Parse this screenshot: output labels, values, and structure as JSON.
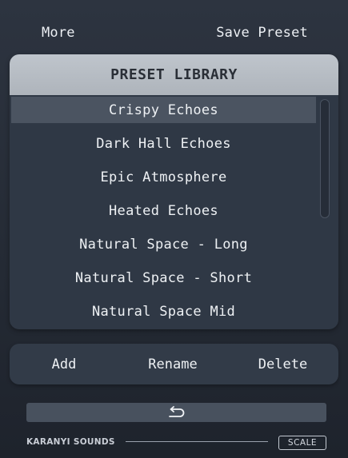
{
  "top_bar": {
    "more_label": "More",
    "save_label": "Save Preset"
  },
  "library": {
    "title": "PRESET LIBRARY",
    "selected_index": 0,
    "presets": [
      "Crispy Echoes",
      "Dark Hall Echoes",
      "Epic Atmosphere",
      "Heated Echoes",
      "Natural Space - Long",
      "Natural Space - Short",
      "Natural Space Mid"
    ]
  },
  "actions": {
    "add_label": "Add",
    "rename_label": "Rename",
    "delete_label": "Delete"
  },
  "undo": {
    "icon": "undo-arrow-icon"
  },
  "footer": {
    "brand": "KARANYI SOUNDS",
    "scale_label": "SCALE"
  },
  "colors": {
    "background": "#262c36",
    "panel": "#2f3845",
    "header": "#b8bec5",
    "selected_row": "#4b5461",
    "text": "#eef1f4"
  }
}
